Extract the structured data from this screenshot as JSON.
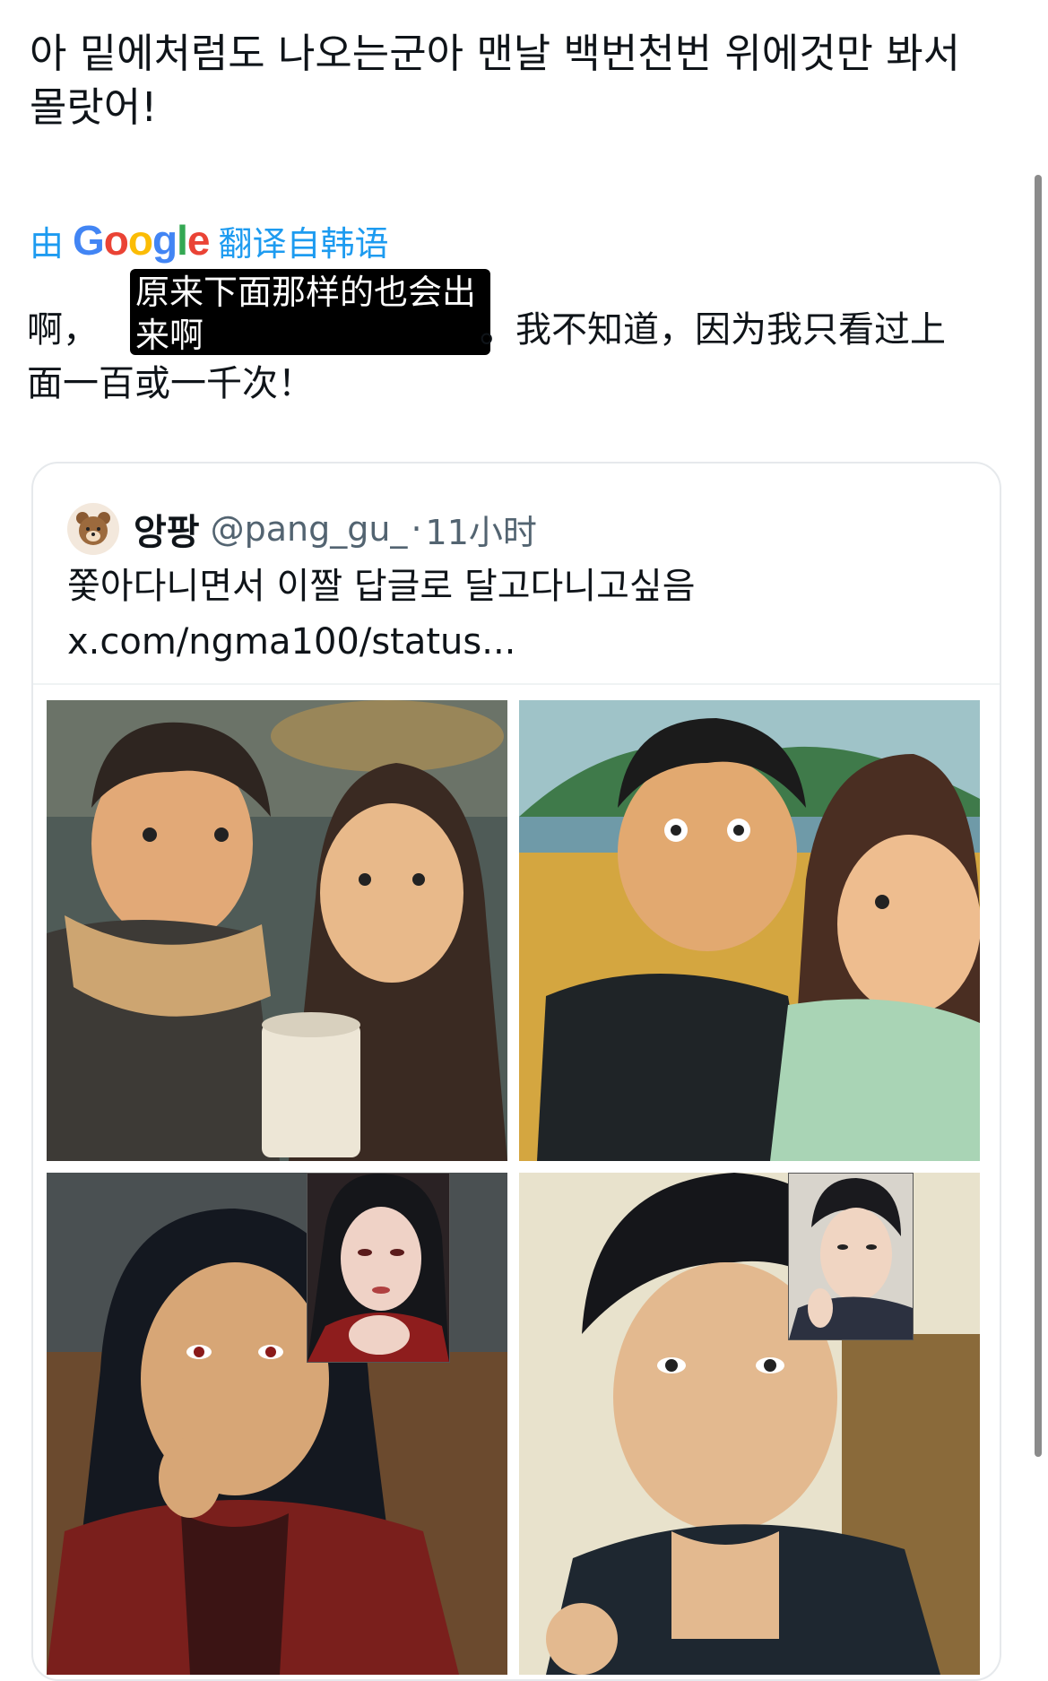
{
  "tweet": {
    "text": "아 밑에처럼도 나오는군아 맨날 백번천번 위에것만 봐서 몰랏어!"
  },
  "translation": {
    "by": "由",
    "provider": "Google",
    "from_language": "翻译自韩语",
    "prefix": "啊，",
    "highlighted": "原来下面那样的也会出来啊",
    "suffix": "。我不知道，因为我只看过上",
    "line2": "面一百或一千次！"
  },
  "quoted_tweet": {
    "display_name": "앙팡",
    "handle": "@pang_gu_",
    "separator": "·",
    "time": "11小时",
    "text": "쫓아다니면서 이짤 답글로 달고다니고싶음 x.com/ngma100/status..."
  },
  "colors": {
    "link_blue": "#1d9bf0",
    "text_primary": "#0f1419",
    "text_secondary": "#536471",
    "border": "#e6e9ec"
  },
  "icons": {
    "avatar": "bear-avatar-icon"
  }
}
